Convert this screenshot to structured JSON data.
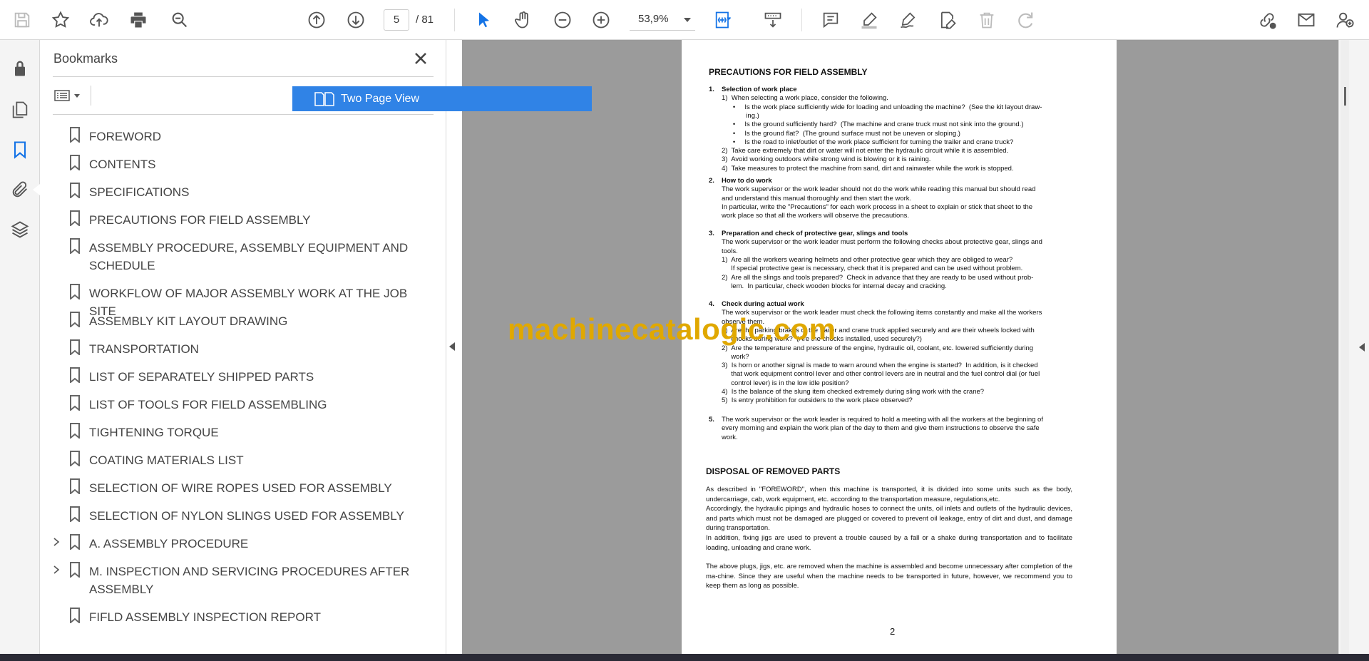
{
  "toolbar": {
    "current_page": "5",
    "page_total": "/ 81",
    "zoom": "53,9%"
  },
  "panel": {
    "title": "Bookmarks",
    "tooltip": "Two Page View"
  },
  "bookmarks": [
    {
      "label": "FOREWORD",
      "expandable": false
    },
    {
      "label": "CONTENTS",
      "expandable": false
    },
    {
      "label": "SPECIFICATIONS",
      "expandable": false
    },
    {
      "label": "PRECAUTIONS FOR FIELD ASSEMBLY",
      "expandable": false
    },
    {
      "label": "ASSEMBLY PROCEDURE, ASSEMBLY EQUIPMENT AND SCHEDULE",
      "expandable": false
    },
    {
      "label": "WORKFLOW OF MAJOR ASSEMBLY WORK AT THE JOB SITE",
      "expandable": false
    },
    {
      "label": "ASSEMBLY KIT LAYOUT DRAWING",
      "expandable": false
    },
    {
      "label": "TRANSPORTATION",
      "expandable": false
    },
    {
      "label": "LIST OF SEPARATELY SHIPPED PARTS",
      "expandable": false
    },
    {
      "label": "LIST OF TOOLS FOR FIELD ASSEMBLING",
      "expandable": false
    },
    {
      "label": "TIGHTENING TORQUE",
      "expandable": false
    },
    {
      "label": "COATING MATERIALS LIST",
      "expandable": false
    },
    {
      "label": "SELECTION OF WIRE ROPES USED FOR ASSEMBLY",
      "expandable": false
    },
    {
      "label": "SELECTION OF NYLON SLINGS USED FOR ASSEMBLY",
      "expandable": false
    },
    {
      "label": "A. ASSEMBLY PROCEDURE",
      "expandable": true
    },
    {
      "label": "M. INSPECTION AND SERVICING PROCEDURES AFTER ASSEMBLY",
      "expandable": true
    },
    {
      "label": "FIFLD ASSEMBLY INSPECTION REPORT",
      "expandable": false
    }
  ],
  "document": {
    "heading": "PRECAUTIONS FOR FIELD ASSEMBLY",
    "sections": [
      {
        "num": "1.",
        "title": "Selection of work place",
        "lines": [
          "1)  When selecting a work place, consider the following.",
          "      •     Is the work place sufficiently wide for loading and unloading the machine?  (See the kit layout draw-",
          "             ing.)",
          "      •     Is the ground sufficiently hard?  (The machine and crane truck must not sink into the ground.)",
          "      •     Is the ground flat?  (The ground surface must not be uneven or sloping.)",
          "      •     Is the road to inlet/outlet of the work place sufficient for turning the trailer and crane truck?",
          "2)  Take care extremely that dirt or water will not enter the hydraulic circuit while it is assembled.",
          "3)  Avoid working outdoors while strong wind is blowing or it is raining.",
          "4)  Take measures to protect the machine from sand, dirt and rainwater while the work is stopped."
        ]
      },
      {
        "num": "2.",
        "title": "How to do work",
        "lines": [
          "The work supervisor or the work leader should not do the work while reading this manual but should read",
          "and understand this manual thoroughly and then start the work.",
          "In particular, write the \"Precautions\" for each work process in a sheet to explain or stick that sheet to the",
          "work place so that all the workers will observe the precautions."
        ]
      },
      {
        "num": "3.",
        "title": "Preparation and check of protective gear, slings and tools",
        "lines": [
          "The work supervisor or the work leader must perform the following checks about protective gear, slings and",
          "tools.",
          "1)  Are all the workers wearing helmets and other protective gear which they are obliged to wear?",
          "     If special protective gear is necessary, check that it is prepared and can be used without problem.",
          "2)  Are all the slings and tools prepared?  Check in advance that they are ready to be used without prob-",
          "     lem.  In particular, check wooden blocks for internal decay and cracking."
        ]
      },
      {
        "num": "4.",
        "title": "Check during actual work",
        "lines": [
          "The work supervisor or the work leader must check the following items constantly and make all the workers",
          "observe them.",
          "1)  Are the parking brakes of the trailer and crane truck applied securely and are their wheels locked with",
          "     chocks during work?  (Are the chocks installed, used securely?)",
          "2)  Are the temperature and pressure of the engine, hydraulic oil, coolant, etc. lowered sufficiently during",
          "     work?",
          "3)  Is horn or another signal is made to warn around when the engine is started?  In addition, is it checked",
          "     that work equipment control lever and other control levers are in neutral and the fuel control dial (or fuel",
          "     control lever) is in the low idle position?",
          "4)  Is the balance of the slung item checked extremely during sling work with the crane?",
          "5)  Is entry prohibition for outsiders to the work place observed?"
        ]
      },
      {
        "num": "5.",
        "title": "",
        "lines": [
          "The work supervisor or the work leader is required to hold a meeting with all the workers at the beginning of",
          "every morning and explain the work plan of the day to them and give them instructions to observe the safe",
          "work."
        ]
      }
    ],
    "heading2": "DISPOSAL OF REMOVED PARTS",
    "paragraphs": [
      "As described in \"FOREWORD\", when this machine is transported, it is divided into some units such as the body, undercarriage, cab, work equipment, etc. according to the transportation measure, regulations,etc.",
      "Accordingly, the hydraulic pipings and hydraulic hoses to connect the units, oil inlets and outlets of the hydraulic devices, and parts which must not be damaged are plugged or covered to prevent oil leakage, entry of dirt and dust, and damage during transportation.",
      "In addition, fixing jigs are used to prevent a trouble caused by a fall or a shake during transportation and to facilitate loading, unloading and crane work.",
      "The above plugs, jigs, etc. are removed when the machine is assembled and become unnecessary after completion of the ma-chine. Since they are useful when the machine needs to be transported in future, however, we recommend you to keep them as long as possible."
    ],
    "page_number": "2"
  },
  "watermark": "machinecatalogic.com",
  "icons": {
    "save": "save-icon",
    "star": "star-icon",
    "upload": "cloud-upload-icon",
    "print": "print-icon",
    "find": "search-icon"
  }
}
